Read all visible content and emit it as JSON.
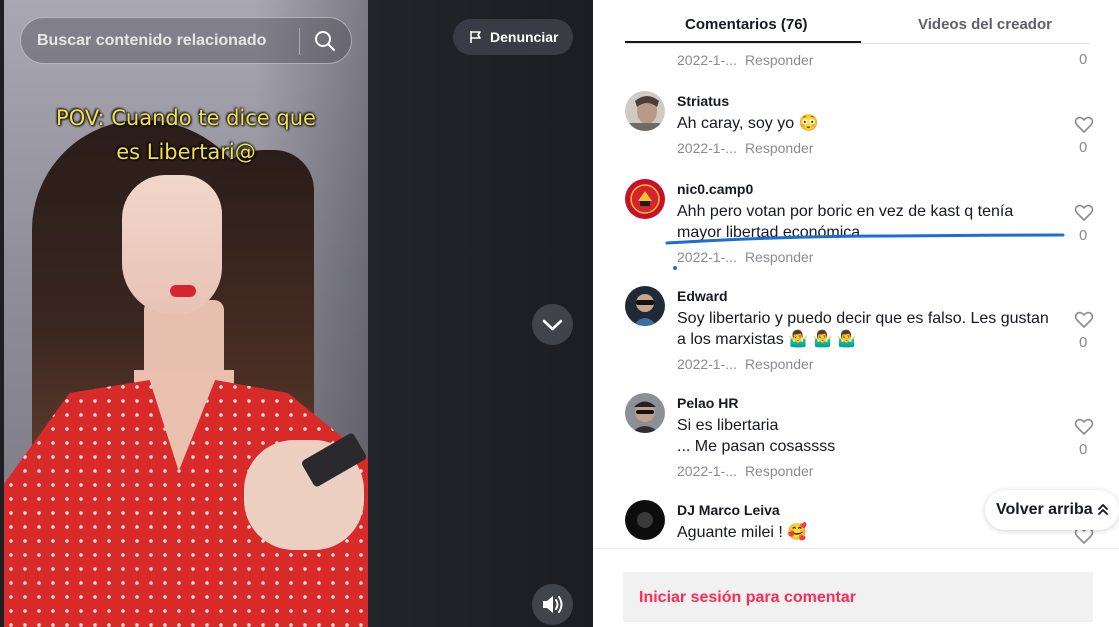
{
  "video": {
    "caption_line1": "POV: Cuando te dice que",
    "caption_line2": "es Libertari@",
    "search_placeholder": "Buscar contenido relacionado",
    "report_label": "Denunciar",
    "icons": {
      "search": "search-icon",
      "report": "flag-icon",
      "next": "chevron-down-icon",
      "volume": "speaker-icon"
    }
  },
  "tabs": {
    "comments": "Comentarios (76)",
    "creator_videos": "Videos del creador"
  },
  "comments": [
    {
      "username": "",
      "text": "",
      "date": "2022-1-...",
      "reply": "Responder",
      "likes": "0",
      "partial": true
    },
    {
      "username": "Striatus",
      "text": "Ah caray, soy yo 😳",
      "date": "2022-1-...",
      "reply": "Responder",
      "likes": "0"
    },
    {
      "username": "nic0.camp0",
      "text": "Ahh pero votan por boric en vez de kast q tenía mayor libertad económica",
      "date": "2022-1-...",
      "reply": "Responder",
      "likes": "0"
    },
    {
      "username": "Edward",
      "text": "Soy libertario y puedo decir que es falso. Les gustan a los marxistas 🤷‍♂️ 🤷‍♂️ 🤷‍♂️",
      "date": "2022-1-...",
      "reply": "Responder",
      "likes": "0"
    },
    {
      "username": "Pelao HR",
      "text_line1": "Si es libertaria",
      "text_line2": "... Me pasan cosassss",
      "date": "2022-1-...",
      "reply": "Responder",
      "likes": "0"
    },
    {
      "username": "DJ Marco Leiva",
      "text": "Aguante milei ! 🥰"
    }
  ],
  "scroll_top_label": "Volver arriba",
  "login_prompt": "Iniciar sesión para comentar",
  "colors": {
    "accent": "#fe2c55",
    "annotation_line": "#1a6fd6",
    "caption": "#f4e04a"
  }
}
